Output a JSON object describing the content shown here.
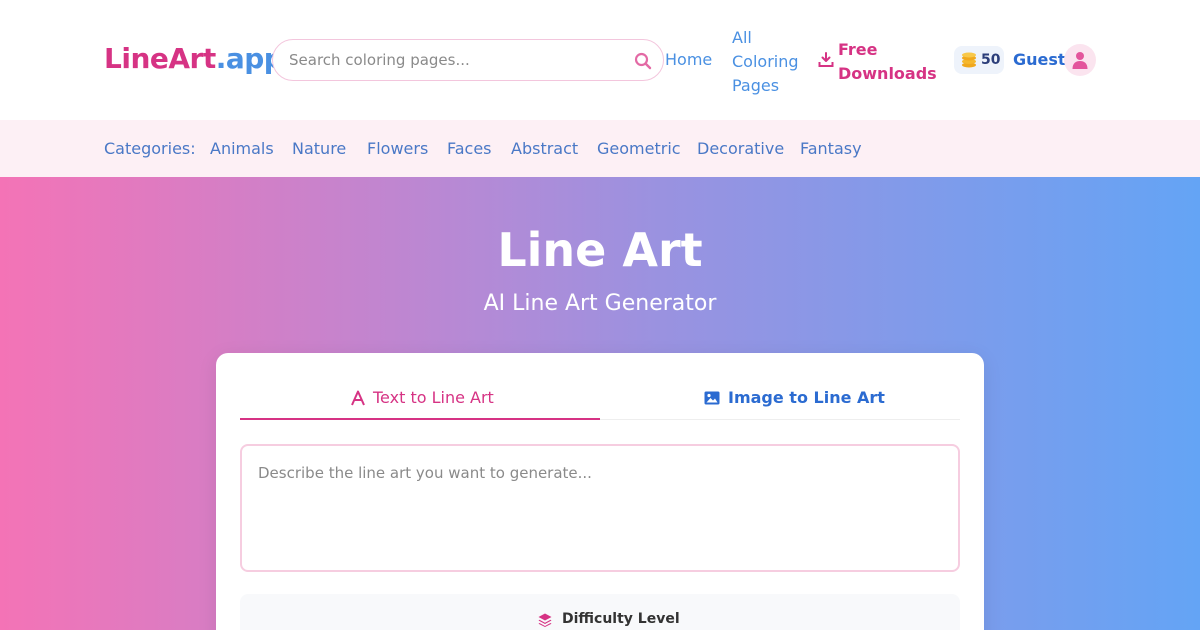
{
  "brand": {
    "part1": "LineArt",
    "part2": ".app"
  },
  "search": {
    "placeholder": "Search coloring pages..."
  },
  "nav": {
    "home": "Home",
    "all_coloring_pages": "All Coloring Pages",
    "free_downloads": "Free Downloads"
  },
  "user": {
    "credits": "50",
    "name": "Guest"
  },
  "categories": {
    "label": "Categories:",
    "items": [
      "Animals",
      "Nature",
      "Flowers",
      "Faces",
      "Abstract",
      "Geometric",
      "Decorative",
      "Fantasy"
    ]
  },
  "hero": {
    "title": "Line Art",
    "subtitle": "AI Line Art Generator"
  },
  "tabs": [
    {
      "label": "Text to Line Art",
      "icon": "font-icon",
      "active": true
    },
    {
      "label": "Image to Line Art",
      "icon": "image-icon",
      "active": false
    }
  ],
  "prompt": {
    "placeholder": "Describe the line art you want to generate..."
  },
  "difficulty": {
    "label": "Difficulty Level",
    "icon": "layers-icon"
  },
  "colors": {
    "pink": "#d63384",
    "blue": "#4a90e2",
    "gradient_start": "#f473b6",
    "gradient_end": "#64a4f5"
  }
}
